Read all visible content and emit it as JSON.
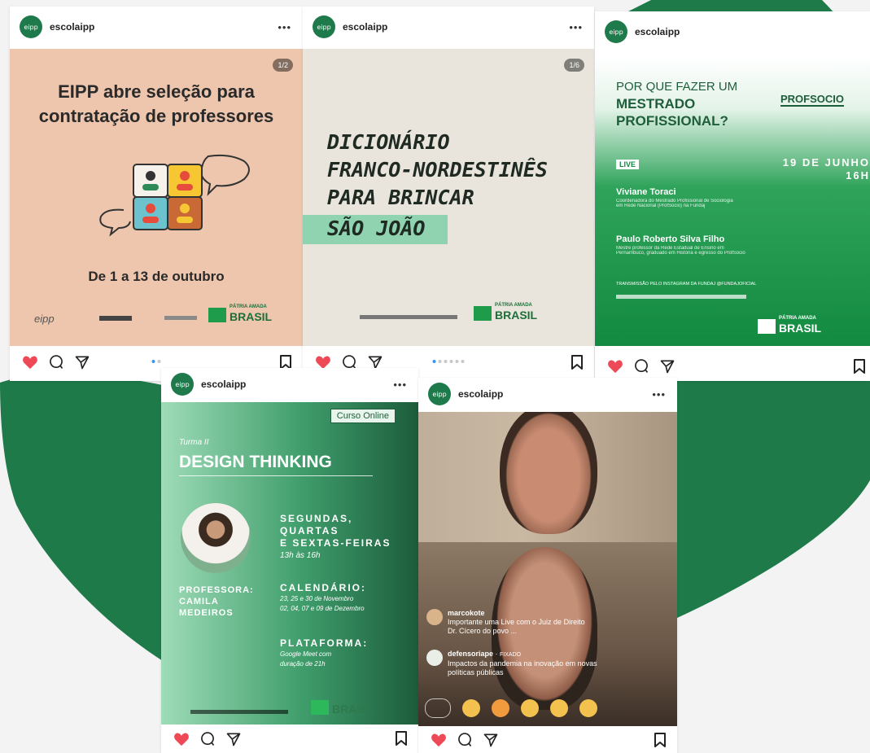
{
  "colors": {
    "accent_green": "#1f7a4a",
    "heart_red": "#ed4956",
    "post1_bg": "#edc6ad",
    "light_green": "#8fd3b0"
  },
  "cards": [
    {
      "username": "escolaipp",
      "avatar_text": "eipp",
      "pager": "1/2"
    },
    {
      "username": "escolaipp",
      "avatar_text": "eipp",
      "pager": "1/6"
    },
    {
      "username": "escolaipp",
      "avatar_text": "eipp"
    },
    {
      "username": "escolaipp",
      "avatar_text": "eipp"
    },
    {
      "username": "escolaipp",
      "avatar_text": "eipp"
    }
  ],
  "post1": {
    "title_l1": "EIPP abre seleção para",
    "title_l2": "contratação de professores",
    "dates": "De 1 a 13 de outubro",
    "logo_left": "eipp",
    "brasil_small": "PÁTRIA AMADA",
    "brasil": "BRASIL"
  },
  "post2": {
    "line1": "DICIONÁRIO",
    "line2": "FRANCO-NORDESTINÊS",
    "line3": "PARA BRINCAR",
    "line4": "SÃO JOÃO",
    "brasil_small": "PÁTRIA AMADA",
    "brasil": "BRASIL"
  },
  "post3": {
    "q1": "POR QUE FAZER UM",
    "q2": "MESTRADO",
    "q3": "PROFISSIONAL?",
    "brand": "PROFSOCIO",
    "live": "LIVE",
    "date": "19 DE JUNHO",
    "time": "16H",
    "sp1_name": "Viviane Toraci",
    "sp1_desc1": "Coordenadora do Mestrado Profissional de Sociologia",
    "sp1_desc2": "em Rede Nacional (ProfSocio) na Fundaj",
    "sp2_name": "Paulo Roberto Silva Filho",
    "sp2_desc1": "Mestre professor da Rede Estadual de Ensino em",
    "sp2_desc2": "Pernambuco, graduado em História e egresso do ProfSocio",
    "transmissao": "TRANSMISSÃO PELO INSTAGRAM DA FUNDAJ @FUNDAJOFICIAL",
    "brasil_small": "PÁTRIA AMADA",
    "brasil": "BRASIL"
  },
  "post4": {
    "badge": "Curso Online",
    "turma": "Turma II",
    "title": "DESIGN THINKING",
    "days1": "SEGUNDAS,",
    "days2": "QUARTAS",
    "days3": "E SEXTAS-FEIRAS",
    "hours": "13h às 16h",
    "prof_label": "PROFESSORA:",
    "prof_name1": "CAMILA",
    "prof_name2": "MEDEIROS",
    "cal_label": "CALENDÁRIO:",
    "cal1": "23, 25 e 30 de Novembro",
    "cal2": "02, 04, 07 e 09 de Dezembro",
    "plat_label": "PLATAFORMA:",
    "plat1": "Google Meet com",
    "plat2": "duração de 21h",
    "brasil": "BRASIL"
  },
  "post5": {
    "c1_user": "marcokote",
    "c1_text1": "Importante uma Live com o Juiz de Direito",
    "c1_text2": "Dr. Cícero do povo ...",
    "c2_user": "defensoriape",
    "c2_tag": "FIXADO",
    "c2_text1": "Impactos da pandemia na inovação em novas",
    "c2_text2": "políticas públicas"
  }
}
